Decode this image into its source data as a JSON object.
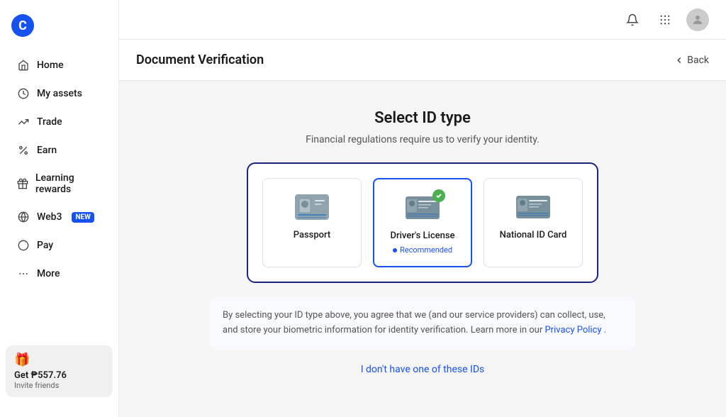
{
  "app": {
    "logo": "C",
    "logo_bg": "#1652f0"
  },
  "sidebar": {
    "items": [
      {
        "id": "home",
        "label": "Home",
        "icon": "🏠"
      },
      {
        "id": "my-assets",
        "label": "My assets",
        "icon": "🕐"
      },
      {
        "id": "trade",
        "label": "Trade",
        "icon": "📈"
      },
      {
        "id": "earn",
        "label": "Earn",
        "icon": "%"
      },
      {
        "id": "learning-rewards",
        "label": "Learning rewards",
        "icon": "🎁"
      },
      {
        "id": "web3",
        "label": "Web3",
        "icon": "🔄",
        "badge": "NEW"
      },
      {
        "id": "pay",
        "label": "Pay",
        "icon": "⭕"
      },
      {
        "id": "more",
        "label": "More",
        "icon": "⋯"
      }
    ],
    "invite": {
      "title": "Get ₱557.76",
      "subtitle": "Invite friends"
    }
  },
  "header": {
    "title": "Document Verification",
    "back_label": "Back"
  },
  "content": {
    "section_title": "Select ID type",
    "section_subtitle": "Financial regulations require us to verify your identity.",
    "id_types": [
      {
        "id": "passport",
        "label": "Passport",
        "selected": false,
        "recommended": false
      },
      {
        "id": "drivers-license",
        "label": "Driver's License",
        "selected": true,
        "recommended": true,
        "recommended_text": "Recommended"
      },
      {
        "id": "national-id",
        "label": "National ID Card",
        "selected": false,
        "recommended": false
      }
    ],
    "disclosure_text": "By selecting your ID type above, you agree that we (and our service providers) can collect, use, and store your biometric information for identity verification. Learn more in our ",
    "privacy_policy_label": "Privacy Policy",
    "disclosure_end": ".",
    "no_id_label": "I don't have one of these IDs"
  }
}
